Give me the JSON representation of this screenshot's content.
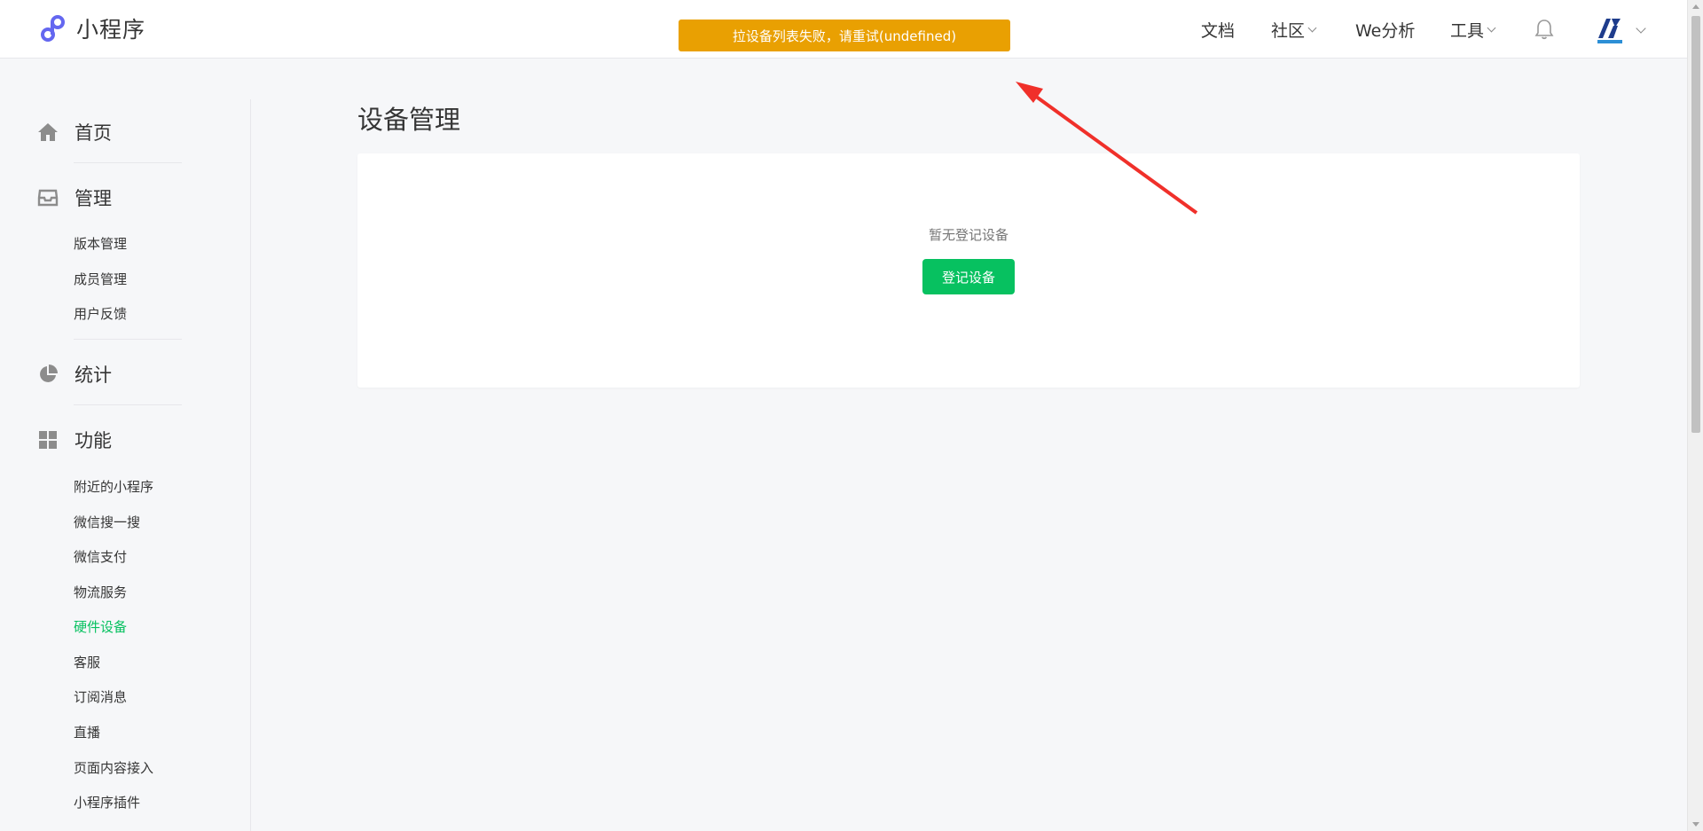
{
  "header": {
    "app_name": "小程序",
    "toast": "拉设备列表失败，请重试(undefined)",
    "nav": {
      "docs": "文档",
      "community": "社区",
      "analytics": "We分析",
      "tools": "工具"
    }
  },
  "sidebar": {
    "home": "首页",
    "manage": {
      "label": "管理",
      "items": [
        "版本管理",
        "成员管理",
        "用户反馈"
      ]
    },
    "stats": "统计",
    "features": {
      "label": "功能",
      "items": [
        "附近的小程序",
        "微信搜一搜",
        "微信支付",
        "物流服务",
        "硬件设备",
        "客服",
        "订阅消息",
        "直播",
        "页面内容接入",
        "小程序插件"
      ],
      "active": "硬件设备"
    }
  },
  "main": {
    "title": "设备管理",
    "empty_text": "暂无登记设备",
    "register_button": "登记设备"
  },
  "colors": {
    "accent": "#07c160",
    "toast": "#e9a002",
    "annotation_arrow": "#f0302a"
  }
}
